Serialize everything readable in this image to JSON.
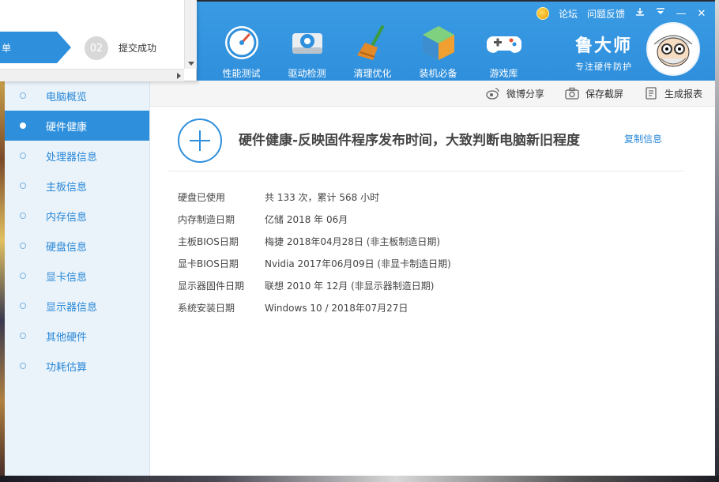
{
  "topbar": {
    "forum": "论坛",
    "feedback": "问题反馈",
    "download_icon": "download-icon",
    "menu_icon": "menu-down-icon",
    "minimize": "—",
    "close": "✕"
  },
  "nav": [
    {
      "label": "性能测试",
      "icon": "speedometer-icon"
    },
    {
      "label": "驱动检测",
      "icon": "driver-gear-icon"
    },
    {
      "label": "清理优化",
      "icon": "broom-icon"
    },
    {
      "label": "装机必备",
      "icon": "box-icon"
    },
    {
      "label": "游戏库",
      "icon": "gamepad-icon"
    }
  ],
  "brand": {
    "name": "鲁大师",
    "slogan": "专注硬件防护"
  },
  "sidebar": {
    "items": [
      {
        "label": "电脑概览"
      },
      {
        "label": "硬件健康",
        "active": true
      },
      {
        "label": "处理器信息"
      },
      {
        "label": "主板信息"
      },
      {
        "label": "内存信息"
      },
      {
        "label": "硬盘信息"
      },
      {
        "label": "显卡信息"
      },
      {
        "label": "显示器信息"
      },
      {
        "label": "其他硬件"
      },
      {
        "label": "功耗估算"
      }
    ]
  },
  "toolbar": {
    "weibo": "微博分享",
    "screenshot": "保存截屏",
    "report": "生成报表"
  },
  "main": {
    "headline": "硬件健康-反映固件程序发布时间，大致判断电脑新旧程度",
    "copy": "复制信息",
    "rows": [
      {
        "k": "硬盘已使用",
        "v": "共 133 次，累计 568 小时"
      },
      {
        "k": "内存制造日期",
        "v": "亿储 2018 年 06月"
      },
      {
        "k": "主板BIOS日期",
        "v": "梅捷 2018年04月28日 (非主板制造日期)"
      },
      {
        "k": "显卡BIOS日期",
        "v": "Nvidia 2017年06月09日 (非显卡制造日期)"
      },
      {
        "k": "显示器固件日期",
        "v": "联想 2010 年 12月 (非显示器制造日期)"
      },
      {
        "k": "系统安装日期",
        "v": "Windows 10 / 2018年07月27日"
      }
    ]
  },
  "dialog": {
    "step1": "单",
    "step2_num": "02",
    "step2_label": "提交成功"
  },
  "colors": {
    "accent": "#2e8fdc",
    "header": "#3a9be4",
    "sidebar_bg": "#eaf3fa"
  }
}
